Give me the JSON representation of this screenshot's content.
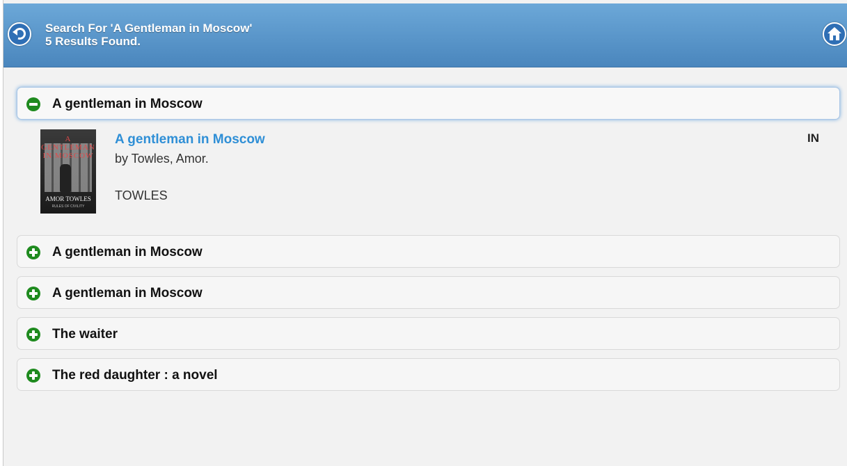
{
  "header": {
    "line1": "Search For 'A Gentleman in Moscow'",
    "line2": "5 Results Found.",
    "back_icon": "back-arrow-icon",
    "home_icon": "home-icon",
    "accent": "#4a86bd"
  },
  "results": [
    {
      "label": "A gentleman in Moscow",
      "expanded": true,
      "icon": "minus-circle-icon",
      "detail": {
        "title": "A gentleman in Moscow",
        "author": "by Towles, Amor.",
        "call_number": "TOWLES",
        "status": "IN",
        "cover": {
          "title_text": "A GENTLEMAN IN MOSCOW",
          "author_text": "AMOR TOWLES",
          "tagline_text": "RULES OF CIVILITY"
        }
      }
    },
    {
      "label": "A gentleman in Moscow",
      "expanded": false,
      "icon": "plus-circle-icon"
    },
    {
      "label": "A gentleman in Moscow",
      "expanded": false,
      "icon": "plus-circle-icon"
    },
    {
      "label": "The waiter",
      "expanded": false,
      "icon": "plus-circle-icon"
    },
    {
      "label": "The red daughter : a novel",
      "expanded": false,
      "icon": "plus-circle-icon"
    }
  ],
  "colors": {
    "icon_green": "#1e8a1e",
    "link_blue": "#2f8fd6"
  }
}
